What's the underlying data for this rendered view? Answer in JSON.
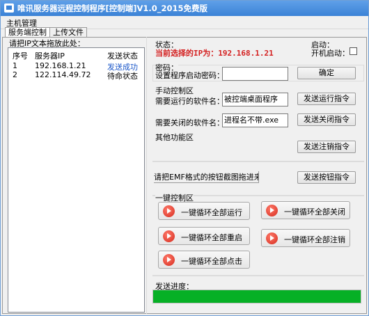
{
  "window": {
    "title": "唯讯服务器远程控制程序[控制端]V1.0_2015免费版"
  },
  "menu": {
    "main": "主机管理"
  },
  "tabs": [
    {
      "label": "服务端控制",
      "active": true
    },
    {
      "label": "上传文件",
      "active": false
    }
  ],
  "left": {
    "hint": "请把IP文本拖放此处：",
    "columns": [
      "序号",
      "服务器IP",
      "发送状态"
    ],
    "rows": [
      {
        "index": "1",
        "ip": "192.168.1.21",
        "status": "发送成功",
        "status_color": "#1a56c8"
      },
      {
        "index": "2",
        "ip": "122.114.49.72",
        "status": "待命状态",
        "status_color": "#000000"
      }
    ]
  },
  "status": {
    "label": "状态：",
    "current": "当前选择的IP为：192.168.1.21",
    "startup_label": "启动：",
    "autostart_label": "开机启动：",
    "autostart_checked": false
  },
  "password": {
    "section": "密码：",
    "label": "设置程序启动密码：",
    "value": "",
    "confirm": "确定"
  },
  "manual": {
    "section": "手动控制区",
    "run_label": "需要运行的软件名：",
    "run_value": "被控端桌面程序",
    "run_button": "发送运行指令",
    "close_label": "需要关闭的软件名：",
    "close_value": "进程名不带.exe",
    "close_button": "发送关闭指令"
  },
  "other": {
    "section": "其他功能区",
    "logout_button": "发送注销指令"
  },
  "emf": {
    "hint": "请把EMF格式的按钮截图拖进来",
    "button": "发送按钮指令"
  },
  "oneclick": {
    "section": "一键控制区",
    "run_all": "一键循环全部运行",
    "close_all": "一键循环全部关闭",
    "restart_all": "一键循环全部重启",
    "logout_all": "一键循环全部注销",
    "click_all": "一键循环全部点击"
  },
  "progress": {
    "label": "发送进度：",
    "value": 1.0,
    "color": "#06b025"
  }
}
